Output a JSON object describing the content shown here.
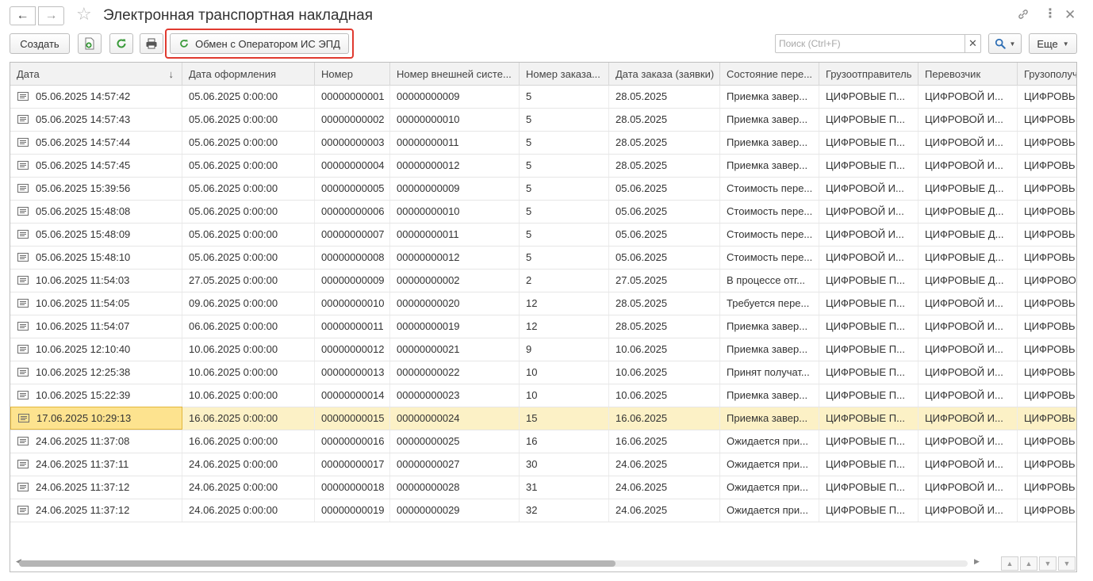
{
  "window": {
    "title": "Электронная транспортная накладная",
    "icons": [
      "link-icon",
      "more-vertical-icon",
      "close-icon"
    ]
  },
  "toolbar": {
    "create_label": "Создать",
    "exchange_label": "Обмен с Оператором ИС ЭПД",
    "search_placeholder": "Поиск (Ctrl+F)",
    "search_value": "",
    "more_label": "Еще"
  },
  "table": {
    "columns": [
      "Дата",
      "Дата оформления",
      "Номер",
      "Номер внешней систе...",
      "Номер заказа...",
      "Дата заказа (заявки)",
      "Состояние пере...",
      "Грузоотправитель",
      "Перевозчик",
      "Грузополуч"
    ],
    "sorted_column_index": 0,
    "sort_direction": "descending",
    "selected_row_index": 14,
    "rows": [
      [
        "05.06.2025 14:57:42",
        "05.06.2025 0:00:00",
        "00000000001",
        "00000000009",
        "5",
        "28.05.2025",
        "Приемка завер...",
        "ЦИФРОВЫЕ П...",
        "ЦИФРОВОЙ И...",
        "ЦИФРОВЬ"
      ],
      [
        "05.06.2025 14:57:43",
        "05.06.2025 0:00:00",
        "00000000002",
        "00000000010",
        "5",
        "28.05.2025",
        "Приемка завер...",
        "ЦИФРОВЫЕ П...",
        "ЦИФРОВОЙ И...",
        "ЦИФРОВЬ"
      ],
      [
        "05.06.2025 14:57:44",
        "05.06.2025 0:00:00",
        "00000000003",
        "00000000011",
        "5",
        "28.05.2025",
        "Приемка завер...",
        "ЦИФРОВЫЕ П...",
        "ЦИФРОВОЙ И...",
        "ЦИФРОВЬ"
      ],
      [
        "05.06.2025 14:57:45",
        "05.06.2025 0:00:00",
        "00000000004",
        "00000000012",
        "5",
        "28.05.2025",
        "Приемка завер...",
        "ЦИФРОВЫЕ П...",
        "ЦИФРОВОЙ И...",
        "ЦИФРОВЬ"
      ],
      [
        "05.06.2025 15:39:56",
        "05.06.2025 0:00:00",
        "00000000005",
        "00000000009",
        "5",
        "05.06.2025",
        "Стоимость пере...",
        "ЦИФРОВОЙ И...",
        "ЦИФРОВЫЕ Д...",
        "ЦИФРОВЬ"
      ],
      [
        "05.06.2025 15:48:08",
        "05.06.2025 0:00:00",
        "00000000006",
        "00000000010",
        "5",
        "05.06.2025",
        "Стоимость пере...",
        "ЦИФРОВОЙ И...",
        "ЦИФРОВЫЕ Д...",
        "ЦИФРОВЬ"
      ],
      [
        "05.06.2025 15:48:09",
        "05.06.2025 0:00:00",
        "00000000007",
        "00000000011",
        "5",
        "05.06.2025",
        "Стоимость пере...",
        "ЦИФРОВОЙ И...",
        "ЦИФРОВЫЕ Д...",
        "ЦИФРОВЬ"
      ],
      [
        "05.06.2025 15:48:10",
        "05.06.2025 0:00:00",
        "00000000008",
        "00000000012",
        "5",
        "05.06.2025",
        "Стоимость пере...",
        "ЦИФРОВОЙ И...",
        "ЦИФРОВЫЕ Д...",
        "ЦИФРОВЬ"
      ],
      [
        "10.06.2025 11:54:03",
        "27.05.2025 0:00:00",
        "00000000009",
        "00000000002",
        "2",
        "27.05.2025",
        "В процессе отг...",
        "ЦИФРОВЫЕ П...",
        "ЦИФРОВЫЕ Д...",
        "ЦИФРОВО"
      ],
      [
        "10.06.2025 11:54:05",
        "09.06.2025 0:00:00",
        "00000000010",
        "00000000020",
        "12",
        "28.05.2025",
        "Требуется пере...",
        "ЦИФРОВЫЕ П...",
        "ЦИФРОВОЙ И...",
        "ЦИФРОВЬ"
      ],
      [
        "10.06.2025 11:54:07",
        "06.06.2025 0:00:00",
        "00000000011",
        "00000000019",
        "12",
        "28.05.2025",
        "Приемка завер...",
        "ЦИФРОВЫЕ П...",
        "ЦИФРОВОЙ И...",
        "ЦИФРОВЬ"
      ],
      [
        "10.06.2025 12:10:40",
        "10.06.2025 0:00:00",
        "00000000012",
        "00000000021",
        "9",
        "10.06.2025",
        "Приемка завер...",
        "ЦИФРОВЫЕ П...",
        "ЦИФРОВОЙ И...",
        "ЦИФРОВЬ"
      ],
      [
        "10.06.2025 12:25:38",
        "10.06.2025 0:00:00",
        "00000000013",
        "00000000022",
        "10",
        "10.06.2025",
        "Принят получат...",
        "ЦИФРОВЫЕ П...",
        "ЦИФРОВОЙ И...",
        "ЦИФРОВЬ"
      ],
      [
        "10.06.2025 15:22:39",
        "10.06.2025 0:00:00",
        "00000000014",
        "00000000023",
        "10",
        "10.06.2025",
        "Приемка завер...",
        "ЦИФРОВЫЕ П...",
        "ЦИФРОВОЙ И...",
        "ЦИФРОВЬ"
      ],
      [
        "17.06.2025 10:29:13",
        "16.06.2025 0:00:00",
        "00000000015",
        "00000000024",
        "15",
        "16.06.2025",
        "Приемка завер...",
        "ЦИФРОВЫЕ П...",
        "ЦИФРОВОЙ И...",
        "ЦИФРОВЬ"
      ],
      [
        "24.06.2025 11:37:08",
        "16.06.2025 0:00:00",
        "00000000016",
        "00000000025",
        "16",
        "16.06.2025",
        "Ожидается при...",
        "ЦИФРОВЫЕ П...",
        "ЦИФРОВОЙ И...",
        "ЦИФРОВЬ"
      ],
      [
        "24.06.2025 11:37:11",
        "24.06.2025 0:00:00",
        "00000000017",
        "00000000027",
        "30",
        "24.06.2025",
        "Ожидается при...",
        "ЦИФРОВЫЕ П...",
        "ЦИФРОВОЙ И...",
        "ЦИФРОВЬ"
      ],
      [
        "24.06.2025 11:37:12",
        "24.06.2025 0:00:00",
        "00000000018",
        "00000000028",
        "31",
        "24.06.2025",
        "Ожидается при...",
        "ЦИФРОВЫЕ П...",
        "ЦИФРОВОЙ И...",
        "ЦИФРОВЬ"
      ],
      [
        "24.06.2025 11:37:12",
        "24.06.2025 0:00:00",
        "00000000019",
        "00000000029",
        "32",
        "24.06.2025",
        "Ожидается при...",
        "ЦИФРОВЫЕ П...",
        "ЦИФРОВОЙ И...",
        "ЦИФРОВЬ"
      ]
    ]
  },
  "colors": {
    "accent_green": "#3a9a3a",
    "highlight_red": "#e03a30",
    "selected_row": "#fcf1c6",
    "selected_cell": "#fde38f",
    "search_blue": "#2f6fb5"
  }
}
